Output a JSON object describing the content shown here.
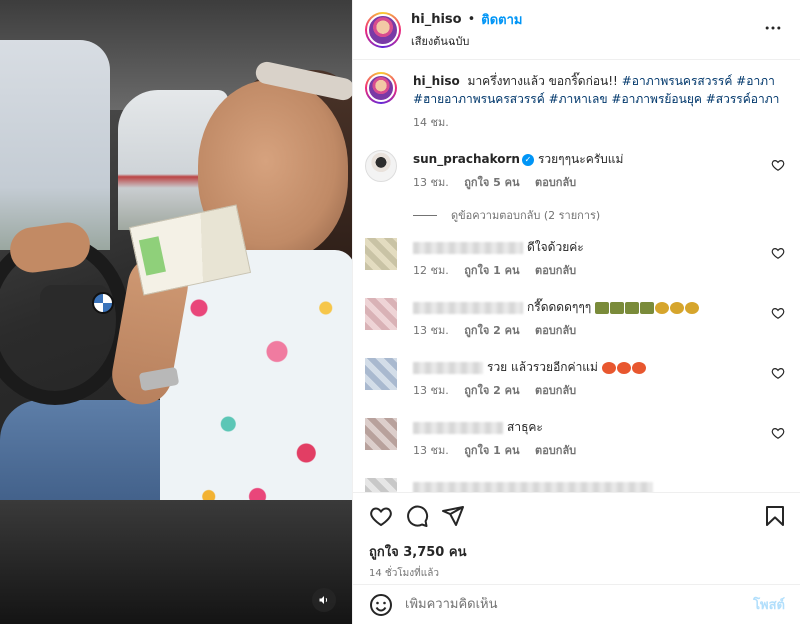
{
  "media": {
    "mute_icon": "speaker-icon"
  },
  "post": {
    "username": "hi_hiso",
    "separator": "•",
    "follow_label": "ติดตาม",
    "audio_label": "เสียงต้นฉบับ",
    "more_icon": "ellipsis-icon"
  },
  "caption": {
    "username": "hi_hiso",
    "text": "มาครึ่งทางแล้ว ขอกริ๊ดก่อน!!",
    "hashtags": "#อาภาพรนครสวรรค์ #อาภา #ฮายอาภาพรนครสวรรค์ #ภาหาเลข #อาภาพรย้อนยุค #สวรรค์อาภา",
    "time": "14 ชม."
  },
  "comments": [
    {
      "username": "sun_prachakorn",
      "verified": true,
      "text": "รวยๆๆนะครับแม่",
      "time": "13 ชม.",
      "likes": "ถูกใจ 5 คน",
      "reply": "ตอบกลับ",
      "view_replies": "ดูข้อความตอบกลับ (2 รายการ)"
    },
    {
      "text": "ดีใจด้วยค่ะ",
      "time": "12 ชม.",
      "likes": "ถูกใจ 1 คน",
      "reply": "ตอบกลับ"
    },
    {
      "text": "กรี๊ดดดดๆๆๆ",
      "time": "13 ชม.",
      "likes": "ถูกใจ 2 คน",
      "reply": "ตอบกลับ"
    },
    {
      "text": "รวย แล้วรวยอีกค่าแม่",
      "time": "13 ชม.",
      "likes": "ถูกใจ 2 คน",
      "reply": "ตอบกลับ"
    },
    {
      "text": "สาธุคะ",
      "time": "13 ชม.",
      "likes": "ถูกใจ 1 คน",
      "reply": "ตอบกลับ"
    }
  ],
  "actions": {
    "like_icon": "heart-icon",
    "comment_icon": "comment-icon",
    "share_icon": "share-icon",
    "save_icon": "bookmark-icon",
    "likes_text": "ถูกใจ 3,750 คน",
    "time_ago": "14 ชั่วโมงที่แล้ว"
  },
  "add_comment": {
    "placeholder": "เพิ่มความคิดเห็น",
    "post_label": "โพสต์"
  },
  "colors": {
    "accent": "#0095f6",
    "post_disabled": "#b2dffc"
  }
}
